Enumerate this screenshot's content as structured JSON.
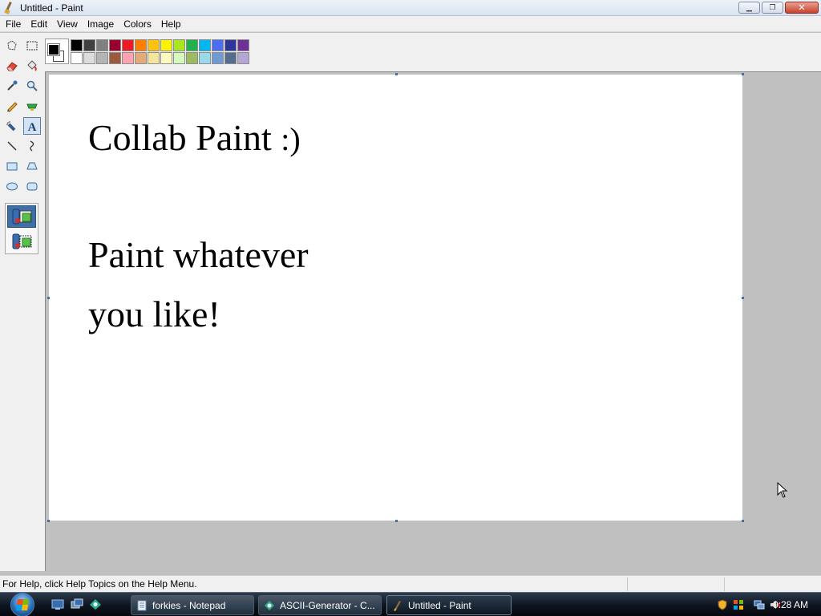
{
  "window": {
    "title": "Untitled - Paint",
    "buttons": {
      "minimize": "▁",
      "restore": "❐",
      "close": "✕"
    }
  },
  "menu": [
    "File",
    "Edit",
    "View",
    "Image",
    "Colors",
    "Help"
  ],
  "colors": {
    "foreground": "#000000",
    "background": "#ffffff",
    "palette_top": [
      "#000000",
      "#404040",
      "#808080",
      "#990030",
      "#ed1c24",
      "#ff7e00",
      "#ffc20e",
      "#fff200",
      "#a8e61d",
      "#22b14c",
      "#00b7ef",
      "#4d6df3",
      "#2f3699",
      "#6f3198"
    ],
    "palette_bottom": [
      "#ffffff",
      "#dcdcdc",
      "#b4b4b4",
      "#9c5a3c",
      "#ffa3b1",
      "#e5aa7a",
      "#f5e49c",
      "#fff9bd",
      "#d3f9bc",
      "#9dbb61",
      "#99d9ea",
      "#709ad1",
      "#546d8e",
      "#b5a5d5"
    ]
  },
  "tools": [
    "free-form-select",
    "select",
    "eraser",
    "fill-with-color",
    "pick-color",
    "magnifier",
    "pencil",
    "brush",
    "airbrush",
    "text",
    "line",
    "curve",
    "rectangle",
    "polygon",
    "ellipse",
    "rounded-rectangle"
  ],
  "selected_tool": "text",
  "canvas": {
    "line1": "Collab Paint ",
    "line1_smiley": ":)",
    "line2": "Paint whatever",
    "line3": "you like!"
  },
  "status": {
    "text": "For Help, click Help Topics on the Help Menu."
  },
  "taskbar": {
    "tasks": [
      "forkies - Notepad",
      "ASCII-Generator - C...",
      "Untitled - Paint"
    ],
    "active_task": "Untitled - Paint",
    "clock": "9:28 AM"
  }
}
